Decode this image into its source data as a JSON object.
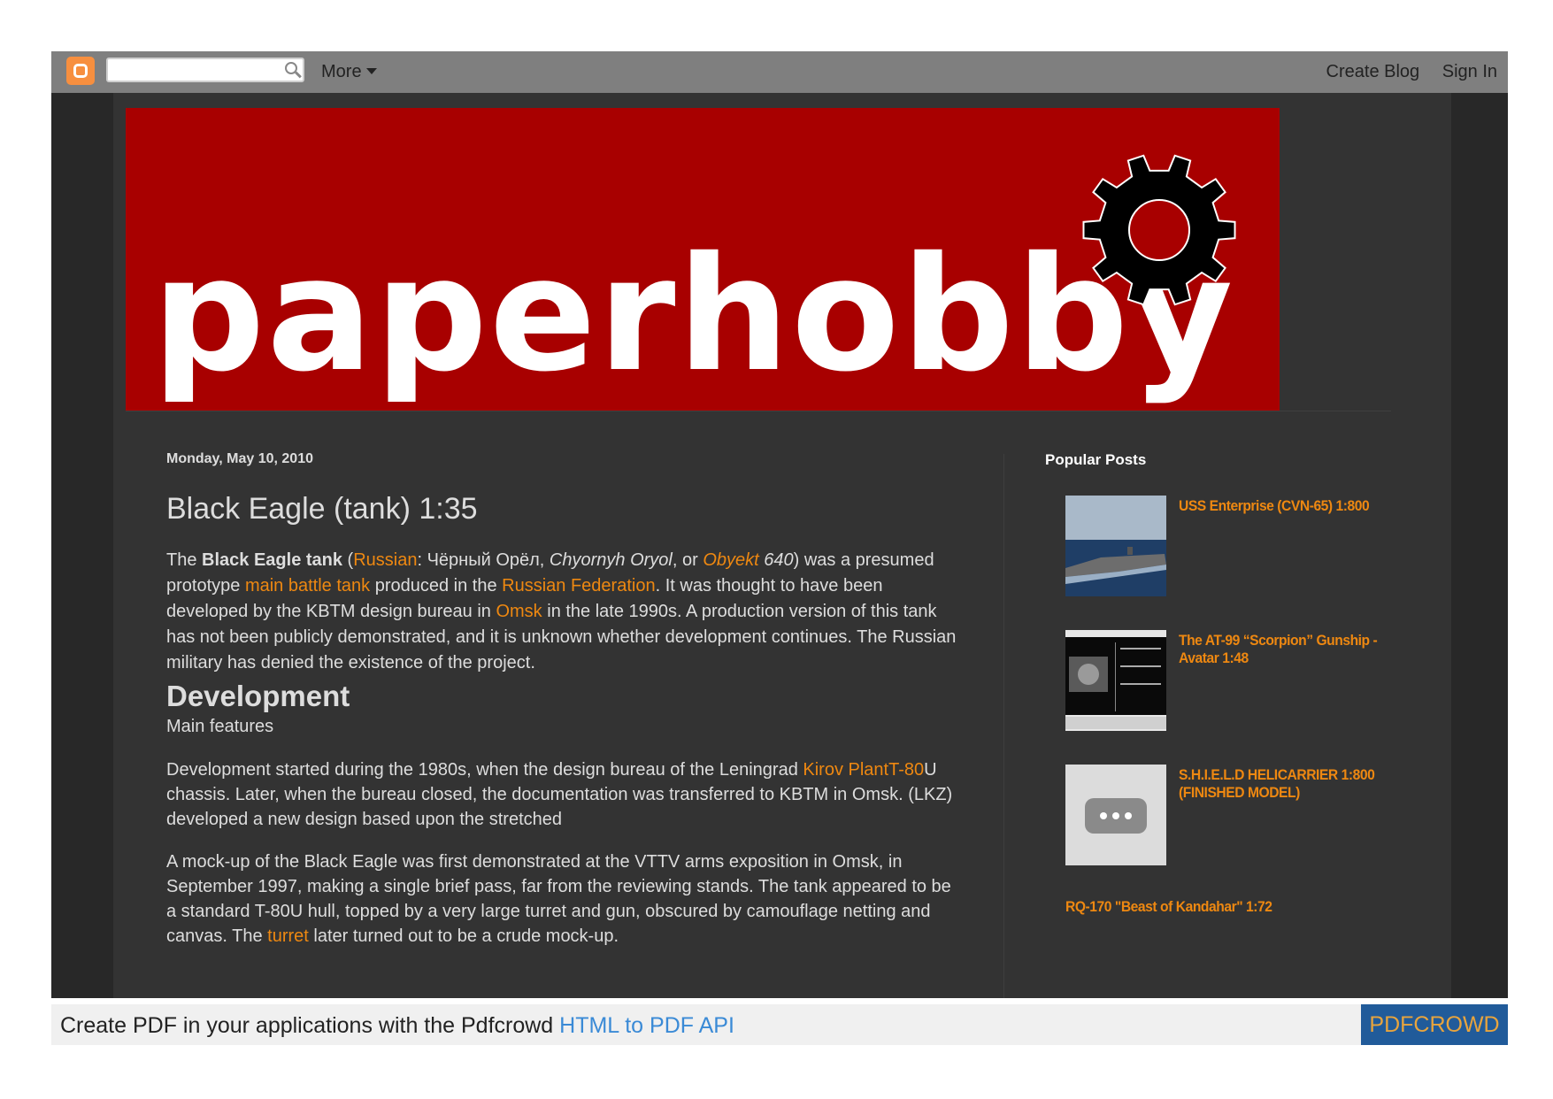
{
  "navbar": {
    "more_label": "More",
    "create_blog": "Create Blog",
    "sign_in": "Sign In"
  },
  "banner": {
    "title": "paperhobby"
  },
  "post": {
    "date": "Monday, May 10, 2010",
    "title": "Black Eagle (tank) 1:35",
    "p1": {
      "t1": "The ",
      "bold": "Black Eagle tank",
      "t2": " (",
      "link_russian": "Russian",
      "t3": ": Чёрный Орёл, ",
      "italic1": "Chyornyh Oryol",
      "t4": ", or ",
      "link_obyekt": "Obyekt",
      "italic2": " 640",
      "t5": ") was a presumed prototype ",
      "link_mbt": "main battle tank",
      "t6": " produced in the ",
      "link_rf": "Russian Federation",
      "t7": ". It was thought to have been developed by the KBTM design bureau in ",
      "link_omsk": "Omsk",
      "t8": " in the late 1990s. A production version of this tank has not been publicly demonstrated, and it is unknown whether development continues. The Russian military has denied the existence of the project."
    },
    "dev_heading": "Development",
    "main_features": "Main features",
    "p2": {
      "t1": "Development started during the 1980s, when the design bureau of the Leningrad ",
      "link_kirov": "Kirov PlantT-80",
      "t2": "U chassis. Later, when the bureau closed, the documentation was transferred to KBTM in Omsk. (LKZ) developed a new design based upon the stretched"
    },
    "p3": {
      "t1": "A mock-up of the Black Eagle was first demonstrated at the VTTV arms exposition in Omsk, in September 1997, making a single brief pass, far from the reviewing stands. The tank appeared to be a standard T-80U hull, topped by a very large turret and gun, obscured by camouflage netting and canvas. The ",
      "link_turret": "turret",
      "t2": " later turned out to be a crude mock-up."
    }
  },
  "sidebar": {
    "title": "Popular Posts",
    "items": [
      {
        "label": "USS Enterprise (CVN-65) 1:800"
      },
      {
        "label": "The AT-99 “Scorpion” Gunship - Avatar 1:48"
      },
      {
        "label": "S.H.I.E.L.D HELICARRIER 1:800 (FINISHED MODEL)"
      },
      {
        "label": "RQ-170 \"Beast of Kandahar\" 1:72"
      }
    ]
  },
  "footer": {
    "text": "Create PDF in your applications with the Pdfcrowd ",
    "link": "HTML to PDF API",
    "badge": "PDFCROWD"
  },
  "colors": {
    "link": "#ee8811",
    "banner": "#a80000",
    "navbar": "#7f7f7f",
    "background": "#333333"
  }
}
